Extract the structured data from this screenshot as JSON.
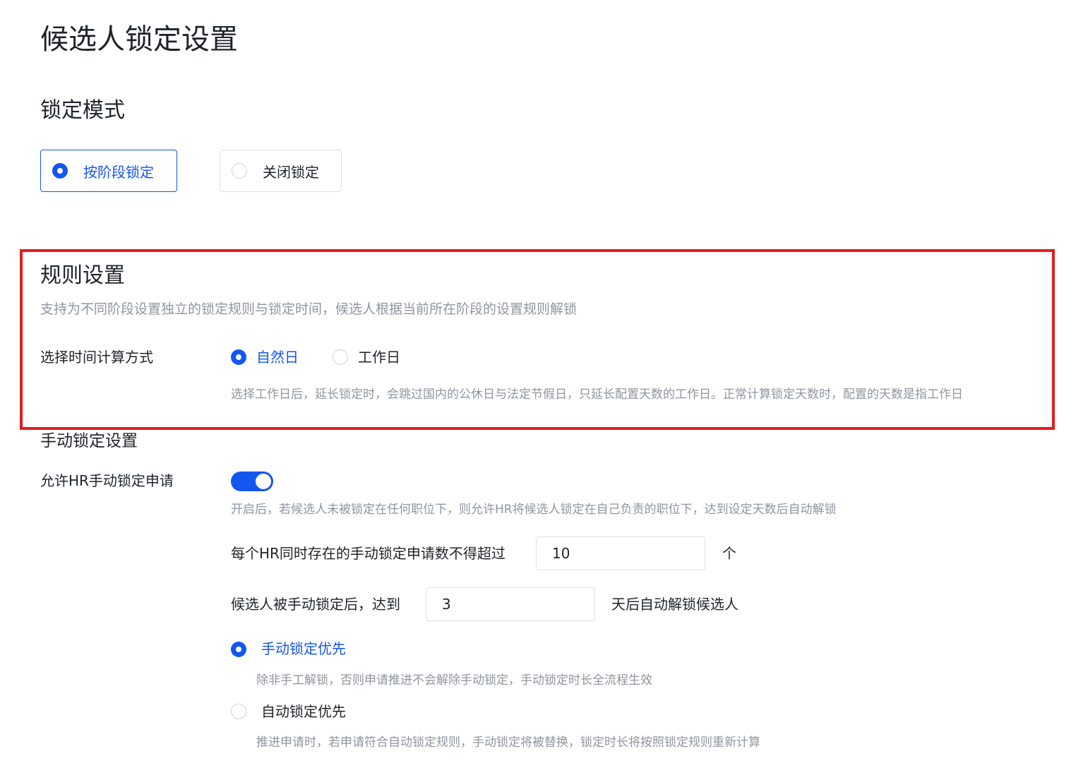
{
  "page": {
    "title": "候选人锁定设置"
  },
  "lock_mode": {
    "title": "锁定模式",
    "options": [
      {
        "label": "按阶段锁定",
        "selected": true
      },
      {
        "label": "关闭锁定",
        "selected": false
      }
    ]
  },
  "rules": {
    "title": "规则设置",
    "description": "支持为不同阶段设置独立的锁定规则与锁定时间，候选人根据当前所在阶段的设置规则解锁",
    "time_calc_label": "选择时间计算方式",
    "time_options": [
      {
        "label": "自然日",
        "selected": true
      },
      {
        "label": "工作日",
        "selected": false
      }
    ],
    "time_hint": "选择工作日后，延长锁定时，会跳过国内的公休日与法定节假日，只延长配置天数的工作日。正常计算锁定天数时，配置的天数是指工作日"
  },
  "manual": {
    "title": "手动锁定设置",
    "allow_label": "允许HR手动锁定申请",
    "allow_enabled": true,
    "allow_hint": "开启后，若候选人未被锁定在任何职位下，则允许HR将候选人锁定在自己负责的职位下，达到设定天数后自动解锁",
    "max_requests_label": "每个HR同时存在的手动锁定申请数不得超过",
    "max_requests_value": "10",
    "max_requests_unit": "个",
    "auto_unlock_label": "候选人被手动锁定后，达到",
    "auto_unlock_value": "3",
    "auto_unlock_suffix": "天后自动解锁候选人",
    "priority_options": [
      {
        "label": "手动锁定优先",
        "selected": true,
        "hint": "除非手工解锁，否则申请推进不会解除手动锁定，手动锁定时长全流程生效"
      },
      {
        "label": "自动锁定优先",
        "selected": false,
        "hint": "推进申请时，若申请符合自动锁定规则，手动锁定将被替换，锁定时长将按照锁定规则重新计算"
      }
    ]
  },
  "colors": {
    "accent": "#1456f0",
    "highlight": "#e51c1c",
    "muted_text": "#8f959e"
  }
}
